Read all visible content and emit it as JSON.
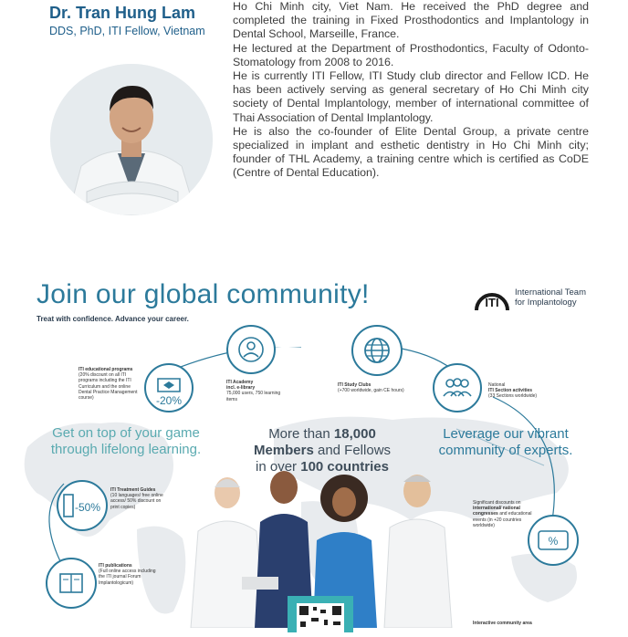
{
  "bio": {
    "name": "Dr. Tran Hung Lam",
    "credentials": "DDS, PhD, ITI Fellow, Vietnam",
    "paragraphs": [
      "Ho Chi Minh city, Viet Nam. He received the PhD degree and completed the training in Fixed Prosthodontics and Implantology in Dental School, Marseille, France.",
      "He lectured at the Department of Prosthodontics, Faculty of Odonto-Stomatology from 2008 to 2016.",
      "He is currently ITI Fellow, ITI Study club director and Fellow ICD. He has been actively serving as general secretary of Ho Chi Minh city society of Dental Implantology, member of international committee of Thai Association of Dental Implantology.",
      "He is also the co-founder of Elite Dental Group, a private centre specialized in implant and esthetic dentistry in Ho Chi Minh city; founder of THL Academy, a training centre which is certified as CoDE (Centre of Dental Education)."
    ]
  },
  "community": {
    "title": "Join our global community!",
    "subtitle": "Treat with confidence. Advance your career.",
    "logo_text": "ITI",
    "logo_name_1": "International Team",
    "logo_name_2": "for Implantology",
    "left_headline_1": "Get on top of your game",
    "left_headline_2": "through lifelong learning.",
    "center_headline_1": "More than",
    "center_headline_num": "18,000",
    "center_headline_2": "Members",
    "center_headline_3": "and Fellows",
    "center_headline_4": "in over",
    "center_headline_num2": "100 countries",
    "right_headline_1": "Leverage our vibrant",
    "right_headline_2": "community of experts.",
    "edu_title": "ITI educational programs",
    "edu_body": "(20% discount on all ITI programs including the ITI Curriculum and the online Dental Practice Management course)",
    "edu_badge": "-20%",
    "academy_title": "ITI Academy",
    "academy_sub": "incl. e-library",
    "academy_body": "75,000 users, 750 learning items",
    "study_title": "ITI Study Clubs",
    "study_body": "(+700 worldwide, gain CE hours)",
    "section_pre": "National",
    "section_title": "ITI Section activities",
    "section_body": "(33 Sections worldwide)",
    "guides_title": "ITI Treatment Guides",
    "guides_body": "(10 languages/ free online access/ 50% discount on print copies)",
    "guides_badge": "-50%",
    "pubs_title": "ITI publications",
    "pubs_body": "(Full online access including the ITI journal Forum Implantologicum)",
    "congress_pre": "Significant discounts on",
    "congress_title": "international/ national congresses",
    "congress_body": "and educational events (in +20 countries worldwide)",
    "congress_badge": "%",
    "interactive_title": "Interactive community area"
  },
  "colors": {
    "brand_blue": "#2c7a9b",
    "light_teal": "#5aaab0",
    "name_blue": "#1f5f8a"
  }
}
